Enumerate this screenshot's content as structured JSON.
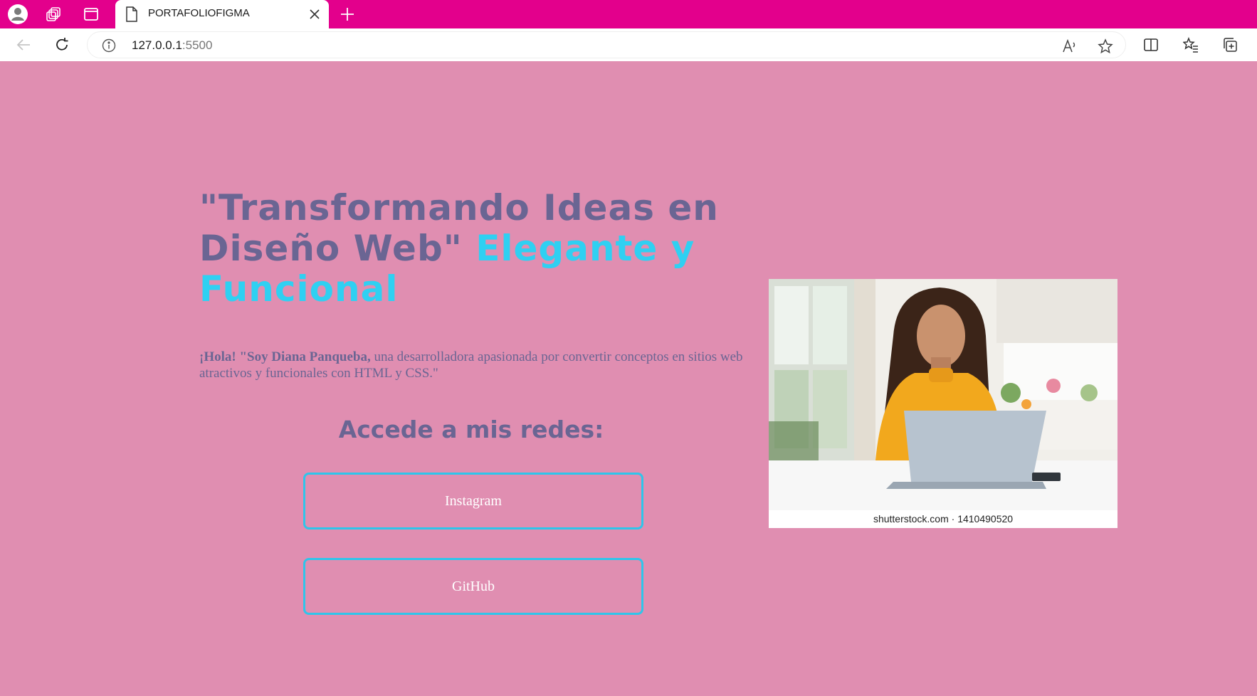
{
  "browser": {
    "tab_title": "PORTAFOLIOFIGMA",
    "url_host": "127.0.0.1",
    "url_port": ":5500",
    "accent_color": "#e3008c"
  },
  "page": {
    "headline_part1": "\"Transformando Ideas en Diseño Web\" ",
    "headline_accent": "Elegante y Funcional",
    "intro_bold": "¡Hola! \"Soy Diana Panqueba,",
    "intro_rest": " una desarrolladora apasionada por convertir conceptos en sitios web atractivos y funcionales con HTML y CSS.\"",
    "networks_title": "Accede a mis redes:",
    "buttons": [
      {
        "label": "Instagram"
      },
      {
        "label": "GitHub"
      }
    ],
    "photo_credit": "shutterstock.com · 1410490520",
    "colors": {
      "background": "#e08eb1",
      "text": "#6a6593",
      "accent": "#2fd0f2"
    }
  }
}
